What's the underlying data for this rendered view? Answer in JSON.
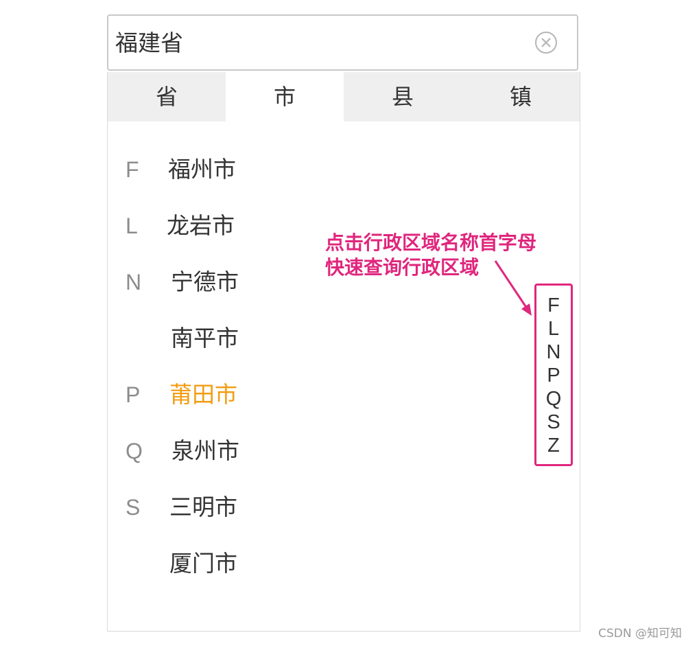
{
  "search": {
    "value": "福建省"
  },
  "tabs": [
    {
      "label": "省",
      "active": false
    },
    {
      "label": "市",
      "active": true
    },
    {
      "label": "县",
      "active": false
    },
    {
      "label": "镇",
      "active": false
    }
  ],
  "cities": [
    {
      "letter": "F",
      "name": "福州市",
      "selected": false
    },
    {
      "letter": "L",
      "name": "龙岩市",
      "selected": false
    },
    {
      "letter": "N",
      "name": "宁德市",
      "selected": false
    },
    {
      "letter": "",
      "name": "南平市",
      "selected": false
    },
    {
      "letter": "P",
      "name": "莆田市",
      "selected": true
    },
    {
      "letter": "Q",
      "name": "泉州市",
      "selected": false
    },
    {
      "letter": "S",
      "name": "三明市",
      "selected": false
    },
    {
      "letter": "",
      "name": "厦门市",
      "selected": false
    }
  ],
  "annotation": {
    "line1": "点击行政区域名称首字母",
    "line2": "快速查询行政区域",
    "color": "#e0267d"
  },
  "index_letters": [
    "F",
    "L",
    "N",
    "P",
    "Q",
    "S",
    "Z"
  ],
  "selected_color": "#f39c12",
  "watermark": "CSDN @知可知"
}
